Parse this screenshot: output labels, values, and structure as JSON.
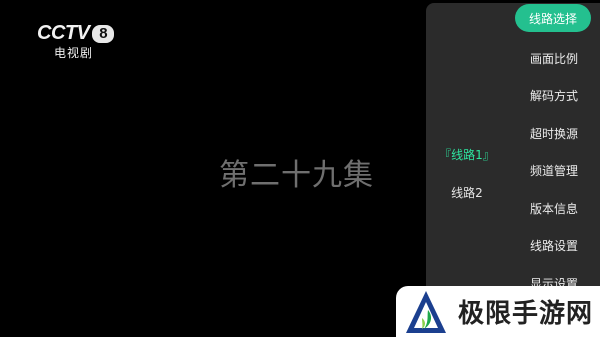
{
  "channel": {
    "name": "CCTV",
    "number": "8",
    "subtitle": "电视剧"
  },
  "episode_title": "第二十九集",
  "routes": [
    {
      "label": "『线路1』",
      "active": true
    },
    {
      "label": "线路2",
      "active": false
    }
  ],
  "menu": [
    {
      "label": "线路选择",
      "active": true
    },
    {
      "label": "画面比例",
      "active": false
    },
    {
      "label": "解码方式",
      "active": false
    },
    {
      "label": "超时换源",
      "active": false
    },
    {
      "label": "频道管理",
      "active": false
    },
    {
      "label": "版本信息",
      "active": false
    },
    {
      "label": "线路设置",
      "active": false
    },
    {
      "label": "显示设置",
      "active": false
    }
  ],
  "watermark": {
    "text": "极限手游网",
    "icon": "triangle-logo-icon"
  },
  "colors": {
    "accent": "#24c08f",
    "active_route": "#2ee6a0",
    "panel": "#2b2b2b",
    "episode_text": "#6f6f6f"
  }
}
